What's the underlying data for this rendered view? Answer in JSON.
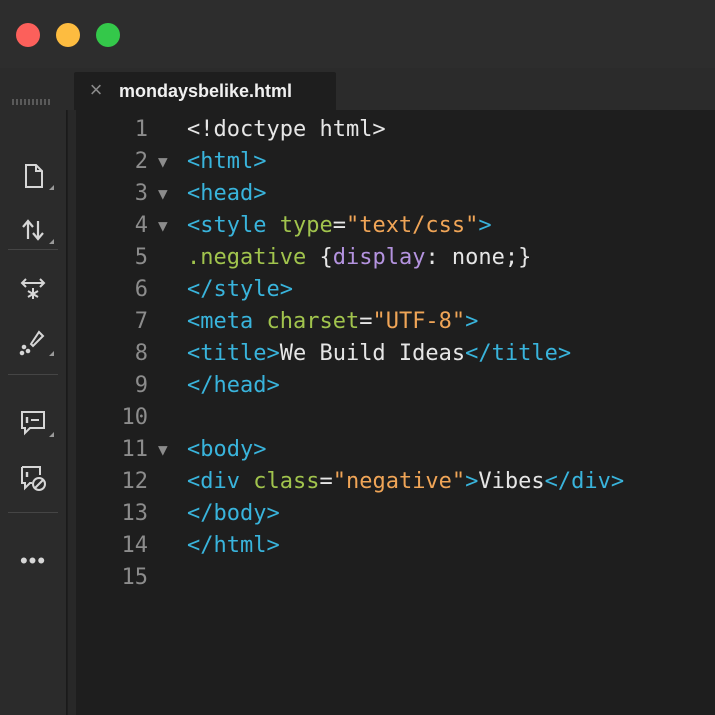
{
  "window": {
    "traffic_lights": {
      "close": "#fc605b",
      "minimize": "#fdbc40",
      "zoom": "#34c84a"
    }
  },
  "toolbar": {
    "tools": [
      {
        "icon": "file-icon"
      },
      {
        "icon": "file-transfer-icon"
      },
      {
        "icon": "live-preview-icon"
      },
      {
        "icon": "extract-icon"
      },
      {
        "icon": "linting-icon"
      },
      {
        "icon": "linting-disabled-icon"
      },
      {
        "icon": "more-icon",
        "label": "•••"
      }
    ]
  },
  "tab": {
    "close_glyph": "×",
    "title": "mondaysbelike.html"
  },
  "editor": {
    "lines": [
      {
        "n": "1",
        "fold": "",
        "tokens": [
          {
            "t": "<!doctype html>",
            "c": "text"
          }
        ]
      },
      {
        "n": "2",
        "fold": "▼",
        "tokens": [
          {
            "t": "<html>",
            "c": "tag"
          }
        ]
      },
      {
        "n": "3",
        "fold": "▼",
        "tokens": [
          {
            "t": "<head>",
            "c": "tag"
          }
        ]
      },
      {
        "n": "4",
        "fold": "▼",
        "tokens": [
          {
            "t": "<style ",
            "c": "tag"
          },
          {
            "t": "type",
            "c": "attr"
          },
          {
            "t": "=",
            "c": "text"
          },
          {
            "t": "\"text/css\"",
            "c": "str"
          },
          {
            "t": ">",
            "c": "tag"
          }
        ]
      },
      {
        "n": "5",
        "fold": "",
        "tokens": [
          {
            "t": ".negative",
            "c": "cls"
          },
          {
            "t": " {",
            "c": "text"
          },
          {
            "t": "display",
            "c": "prop"
          },
          {
            "t": ": none;}",
            "c": "val"
          }
        ]
      },
      {
        "n": "6",
        "fold": "",
        "tokens": [
          {
            "t": "</style>",
            "c": "tag"
          }
        ]
      },
      {
        "n": "7",
        "fold": "",
        "tokens": [
          {
            "t": "<meta ",
            "c": "tag"
          },
          {
            "t": "charset",
            "c": "attr"
          },
          {
            "t": "=",
            "c": "text"
          },
          {
            "t": "\"UTF-8\"",
            "c": "str"
          },
          {
            "t": ">",
            "c": "tag"
          }
        ]
      },
      {
        "n": "8",
        "fold": "",
        "tokens": [
          {
            "t": "<title>",
            "c": "tag"
          },
          {
            "t": "We Build Ideas",
            "c": "text"
          },
          {
            "t": "</title>",
            "c": "tag"
          }
        ]
      },
      {
        "n": "9",
        "fold": "",
        "tokens": [
          {
            "t": "</head>",
            "c": "tag"
          }
        ]
      },
      {
        "n": "10",
        "fold": "",
        "tokens": []
      },
      {
        "n": "11",
        "fold": "▼",
        "tokens": [
          {
            "t": "<body>",
            "c": "tag"
          }
        ]
      },
      {
        "n": "12",
        "fold": "",
        "tokens": [
          {
            "t": "<div ",
            "c": "tag"
          },
          {
            "t": "class",
            "c": "attr"
          },
          {
            "t": "=",
            "c": "text"
          },
          {
            "t": "\"negative\"",
            "c": "str"
          },
          {
            "t": ">",
            "c": "tag"
          },
          {
            "t": "Vibes",
            "c": "text"
          },
          {
            "t": "</div>",
            "c": "tag"
          }
        ]
      },
      {
        "n": "13",
        "fold": "",
        "tokens": [
          {
            "t": "</body>",
            "c": "tag"
          }
        ]
      },
      {
        "n": "14",
        "fold": "",
        "tokens": [
          {
            "t": "</html>",
            "c": "tag"
          }
        ]
      },
      {
        "n": "15",
        "fold": "",
        "tokens": []
      }
    ]
  }
}
